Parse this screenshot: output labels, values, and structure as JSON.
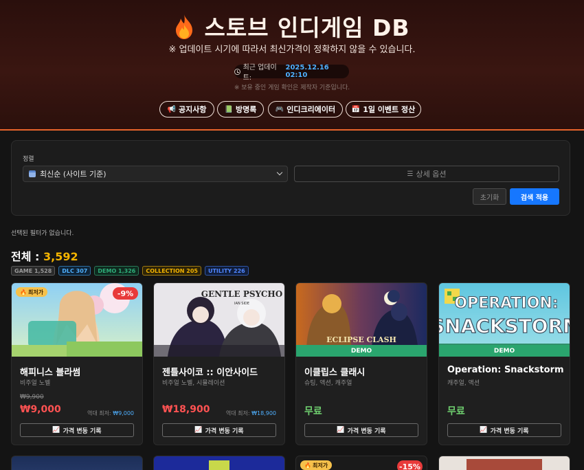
{
  "header": {
    "title": "스토브 인디게임 DB",
    "subtitle": "※ 업데이트 시기에 따라서 최신가격이 정확하지 않을 수 있습니다.",
    "update_label": "최근 업데이트:",
    "update_time": "2025.12.16 02:10",
    "note": "※ 보유 중인 게임 확인은 제작자 기준입니다.",
    "nav": [
      {
        "label": "공지사항",
        "icon": "megaphone-icon"
      },
      {
        "label": "방명록",
        "icon": "book-icon"
      },
      {
        "label": "인디크리에이터",
        "icon": "gamepad-icon"
      },
      {
        "label": "1일 이벤트 정산",
        "icon": "calendar-icon"
      }
    ]
  },
  "filter": {
    "sort_label": "정렬",
    "sort_value": "최신순 (사이트 기준)",
    "detail_label": "상세 옵션",
    "reset_label": "초기화",
    "apply_label": "검색 적용"
  },
  "no_filter_text": "선택된 필터가 없습니다.",
  "total": {
    "label": "전체 :",
    "count": "3,592"
  },
  "tags": [
    {
      "label": "GAME 1,528",
      "color": "#9a9a9a",
      "bg": "#2a2a2a"
    },
    {
      "label": "DLC 307",
      "color": "#4fb0ff",
      "bg": "#0f2437"
    },
    {
      "label": "DEMO 1,326",
      "color": "#2fae7a",
      "bg": "#0e2a1f"
    },
    {
      "label": "COLLECTION 205",
      "color": "#f4b400",
      "bg": "#2e2407"
    },
    {
      "label": "UTILITY 226",
      "color": "#4f86ff",
      "bg": "#101d3a"
    }
  ],
  "cards": [
    {
      "name": "해피니스 블라썸",
      "genre": "비주얼 노벨",
      "original": "₩9,900",
      "price": "₩9,000",
      "low_label": "역대 최저:",
      "low": "₩9,000",
      "badge": "최저가",
      "discount": "-9%",
      "history": "가격 변동 기록"
    },
    {
      "name": "젠틀사이코 :: 이안사이드",
      "genre": "비주얼 노벨, 시뮬레이션",
      "price": "₩18,900",
      "low_label": "역대 최저:",
      "low": "₩18,900",
      "history": "가격 변동 기록",
      "thumb_title": "GENTLE PSYCHO",
      "thumb_sub": "IAN SIDE"
    },
    {
      "name": "이클립스 클래시",
      "genre": "슈팅, 액션, 캐주얼",
      "price": "무료",
      "demo": "DEMO",
      "history": "가격 변동 기록",
      "thumb_title": "ECLIPSE CLASH"
    },
    {
      "name": "Operation: Snackstorm",
      "genre": "캐주얼, 액션",
      "price": "무료",
      "demo": "DEMO",
      "history": "가격 변동 기록",
      "thumb_title": "OPERATION:",
      "thumb_sub": "SNACKSTORM"
    }
  ],
  "row2": [
    {
      "badge": "최저가",
      "discount": "-15%"
    }
  ]
}
